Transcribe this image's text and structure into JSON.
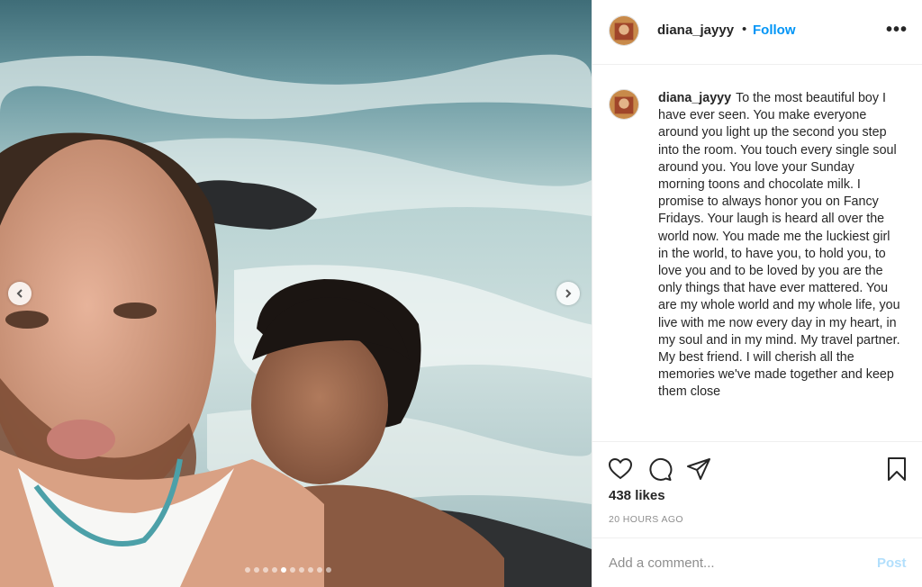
{
  "photo": {
    "carousel": {
      "count": 10,
      "active_index": 4
    }
  },
  "header": {
    "username": "diana_jayyy",
    "separator": "•",
    "follow_label": "Follow",
    "more_label": "•••"
  },
  "caption": {
    "username": "diana_jayyy",
    "text": "To the most beautiful boy I have ever seen. You make everyone around you light up the second you step into the room. You touch every single soul around you. You love your Sunday morning toons and chocolate milk. I promise to always honor you on Fancy Fridays. Your laugh is heard all over the world now. You made me the luckiest girl in the world, to have you, to hold you, to love you and to be loved by you are the only things that have ever mattered. You are my whole world and my whole life, you live with me now every day in my heart, in my soul and in my mind. My travel partner. My best friend. I will cherish all the memories we've made together and keep them close"
  },
  "actions": {
    "icons": [
      "heart-icon",
      "comment-icon",
      "share-icon",
      "bookmark-icon"
    ],
    "likes_text": "438 likes",
    "timestamp": "20 HOURS AGO"
  },
  "comment_box": {
    "placeholder": "Add a comment...",
    "value": "",
    "post_label": "Post"
  },
  "colors": {
    "link_blue": "#0095f6",
    "post_disabled": "#b2dffc",
    "text": "#262626",
    "muted": "#8e8e8e"
  }
}
